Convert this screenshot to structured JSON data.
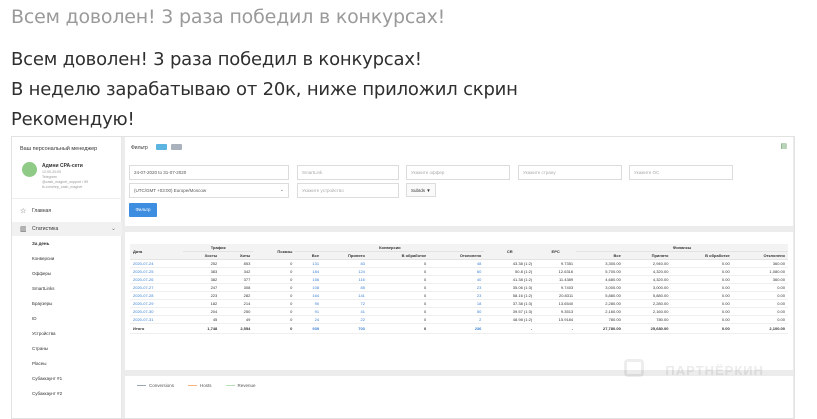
{
  "review": {
    "title": "Всем доволен! 3 раза победил в конкурсах!",
    "lines": [
      "Всем доволен! 3 раза победил в конкурсах!",
      "В неделю зарабатываю от 20к, ниже приложил скрин",
      "Рекомендую!"
    ]
  },
  "sidebar": {
    "header": "Ваш персональный менеджер",
    "manager_name": "Адмни CPA-сети",
    "manager_meta": [
      "12:00-20:00",
      "Telegram",
      "@cash_magnet_support / 89",
      "tk.com/rep_cash_magnet"
    ],
    "nav": [
      {
        "icon": "home-icon",
        "glyph": "☆",
        "label": "Главная"
      },
      {
        "icon": "stats-icon",
        "glyph": "▥",
        "label": "Статистика",
        "chevron": "⌄"
      }
    ],
    "subitems": [
      "За день",
      "Конверсии",
      "Офферы",
      "SmartLinks",
      "Браузеры",
      "ID",
      "Устройства",
      "Страны",
      "Placeы",
      "Субаккаунт #1",
      "Субаккаунт #2"
    ]
  },
  "filters": {
    "label": "Фильтр",
    "chips": [
      " ",
      " "
    ],
    "date_range": "24-07-2020 to 31-07-2020",
    "smartlink_placeholder": "SmartLink",
    "offer_placeholder": "Укажите оффер",
    "country_placeholder": "Укажите страну",
    "os_placeholder": "Укажите ОС",
    "timezone": "(UTC/GMT +03:00) Europe/Moscow",
    "device_placeholder": "Укажите устройство",
    "subids_label": "SubIds ▼",
    "apply_label": "Фильтр"
  },
  "table": {
    "group_headers": {
      "traffic": "Трафик",
      "shows": "Показы",
      "conversions": "Конверсии",
      "cr": "CR",
      "epc": "EPC",
      "finance": "Финансы"
    },
    "columns": [
      "Дата",
      "Хосты",
      "Хиты",
      "Показы",
      "Все",
      "Принято",
      "В обработке",
      "Отклонено",
      "CR",
      "EPC",
      "Все",
      "Принято",
      "В обработке",
      "Отклонено"
    ],
    "rows": [
      [
        "2020-07-24",
        "252",
        "853",
        "0",
        "131",
        "83",
        "0",
        "48",
        "43.38 (1:2)",
        "9.7351",
        "3,300.00",
        "2,940.00",
        "0.00",
        "360.00"
      ],
      [
        "2020-07-25",
        "383",
        "342",
        "0",
        "184",
        "124",
        "0",
        "60",
        "50.8 (1:2)",
        "12.6316",
        "5,700.00",
        "4,320.00",
        "0.00",
        "1,080.00"
      ],
      [
        "2020-07-26",
        "382",
        "377",
        "0",
        "156",
        "116",
        "0",
        "40",
        "41.38 (1:2)",
        "11.4389",
        "4,680.00",
        "4,320.00",
        "0.00",
        "360.00"
      ],
      [
        "2020-07-27",
        "247",
        "308",
        "0",
        "108",
        "85",
        "0",
        "23",
        "35.06 (1:3)",
        "9.7403",
        "3,000.00",
        "3,000.00",
        "0.00",
        "0.00"
      ],
      [
        "2020-07-28",
        "223",
        "282",
        "0",
        "164",
        "141",
        "0",
        "23",
        "58.16 (1:2)",
        "20.8311",
        "5,880.00",
        "5,880.00",
        "0.00",
        "0.00"
      ],
      [
        "2020-07-29",
        "182",
        "214",
        "0",
        "90",
        "72",
        "0",
        "18",
        "37.38 (1:3)",
        "13.6540",
        "2,280.00",
        "2,280.00",
        "0.00",
        "0.00"
      ],
      [
        "2020-07-30",
        "204",
        "250",
        "0",
        "91",
        "41",
        "0",
        "50",
        "39.57 (1:3)",
        "9.3513",
        "2,160.00",
        "2,160.00",
        "0.00",
        "0.00"
      ],
      [
        "2020-07-31",
        "45",
        "49",
        "0",
        "24",
        "22",
        "0",
        "2",
        "48.98 (1:2)",
        "15.9184",
        "780.00",
        "780.00",
        "0.00",
        "0.00"
      ]
    ],
    "totals": [
      "Итого",
      "1,748",
      "2,554",
      "0",
      "939",
      "703",
      "0",
      "236",
      "-",
      "-",
      "27,780.00",
      "25,680.00",
      "0.00",
      "2,100.00"
    ]
  },
  "chart_legend": [
    {
      "label": "Conversions",
      "color": "#9aa6b4"
    },
    {
      "label": "Hosts",
      "color": "#f3b37a"
    },
    {
      "label": "Revenue",
      "color": "#b9dfb5"
    }
  ],
  "watermark": "ПАРТНЁРКИН",
  "colors": {
    "accent": "#3d8ee0",
    "link": "#3a7fd0",
    "avatar": "#8fca86"
  }
}
